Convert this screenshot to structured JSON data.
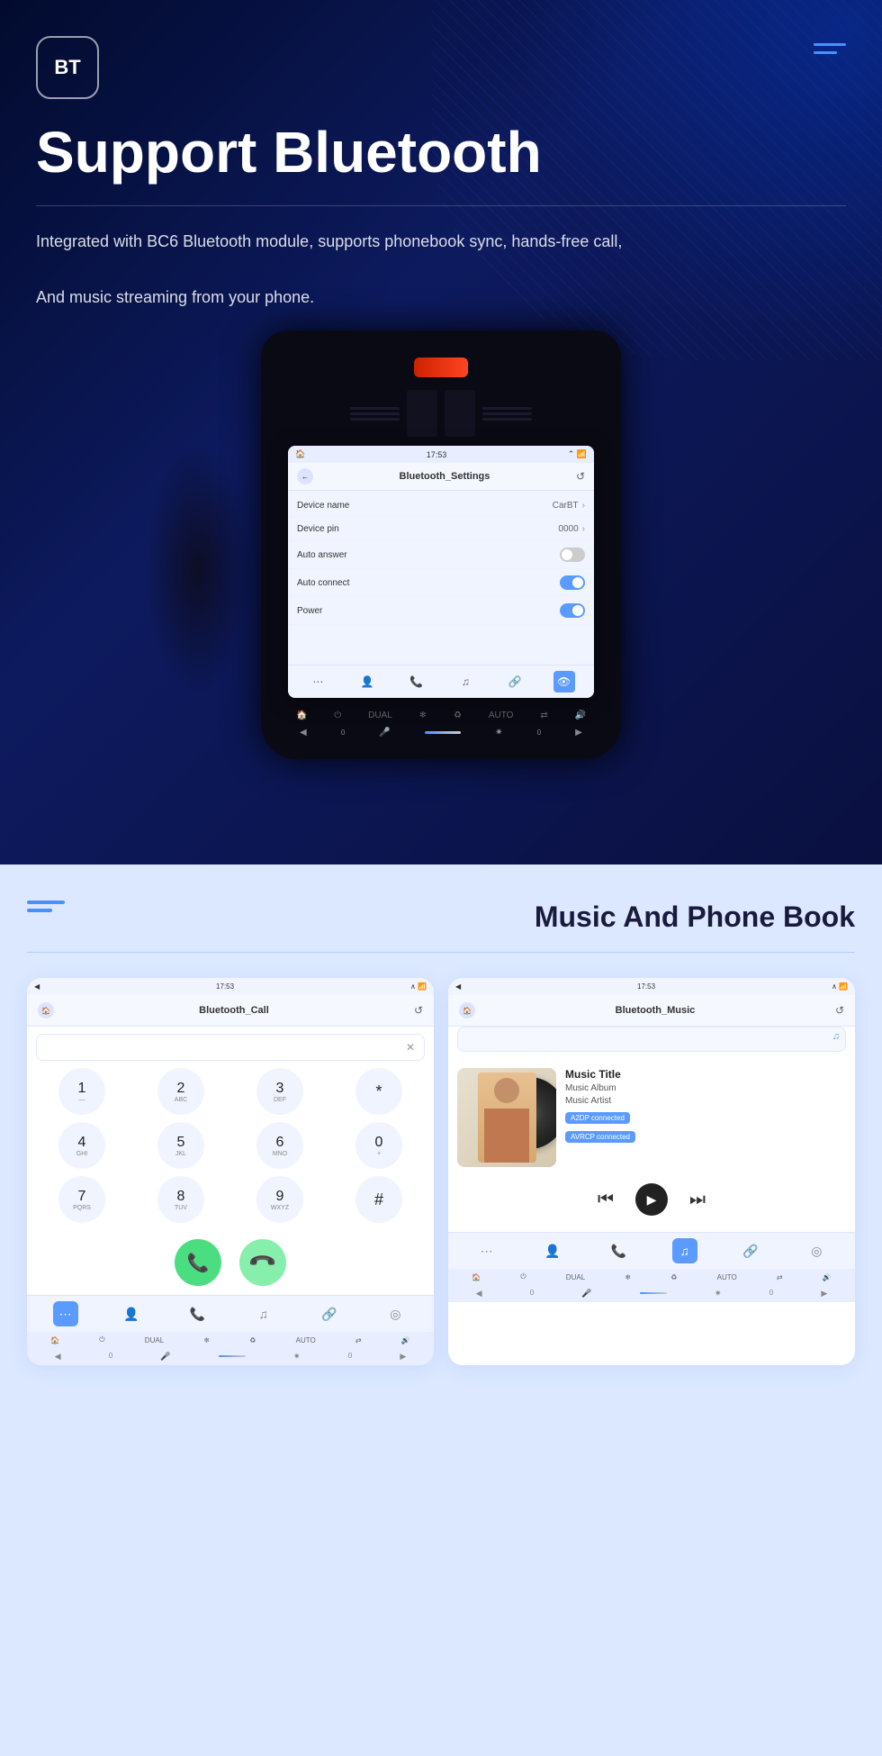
{
  "hero": {
    "bt_label": "BT",
    "title": "Support Bluetooth",
    "description_line1": "Integrated with BC6 Bluetooth module, supports phonebook sync, hands-free call,",
    "description_line2": "And music streaming from your phone.",
    "menu_icon_alt": "menu"
  },
  "tablet": {
    "status_time": "17:53",
    "screen_title": "Bluetooth_Settings",
    "rows": [
      {
        "label": "Device name",
        "value": "CarBT",
        "type": "chevron"
      },
      {
        "label": "Device pin",
        "value": "0000",
        "type": "chevron"
      },
      {
        "label": "Auto answer",
        "value": "",
        "type": "toggle_off"
      },
      {
        "label": "Auto connect",
        "value": "",
        "type": "toggle_on"
      },
      {
        "label": "Power",
        "value": "",
        "type": "toggle_on"
      }
    ]
  },
  "bottom": {
    "section_title": "Music And Phone Book",
    "call_card": {
      "status_time": "17:53",
      "title": "Bluetooth_Call",
      "keys": [
        {
          "main": "1",
          "sub": "—"
        },
        {
          "main": "2",
          "sub": "ABC"
        },
        {
          "main": "3",
          "sub": "DEF"
        },
        {
          "main": "*",
          "sub": ""
        },
        {
          "main": "4",
          "sub": "GHI"
        },
        {
          "main": "5",
          "sub": "JKL"
        },
        {
          "main": "6",
          "sub": "MNO"
        },
        {
          "main": "0",
          "sub": "+"
        },
        {
          "main": "7",
          "sub": "PQRS"
        },
        {
          "main": "8",
          "sub": "TUV"
        },
        {
          "main": "9",
          "sub": "WXYZ"
        },
        {
          "main": "#",
          "sub": ""
        }
      ],
      "call_btn": "📞",
      "hangup_btn": "📞"
    },
    "music_card": {
      "status_time": "17:53",
      "title": "Bluetooth_Music",
      "track_name": "Music Title",
      "track_album": "Music Album",
      "track_artist": "Music Artist",
      "badge_a2dp": "A2DP connected",
      "badge_avrcp": "AVRCP connected"
    }
  }
}
